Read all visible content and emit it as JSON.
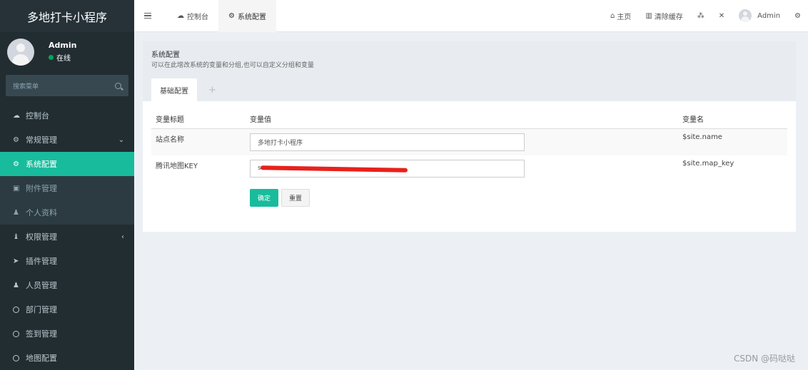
{
  "app": {
    "title": "多地打卡小程序"
  },
  "user": {
    "name": "Admin",
    "status": "在线"
  },
  "sidebar": {
    "search_placeholder": "搜索菜单",
    "items": [
      {
        "label": "控制台",
        "icon": "dashboard-icon",
        "glyph": "☁",
        "style": "normal"
      },
      {
        "label": "常规管理",
        "icon": "cogs-icon",
        "glyph": "⚙",
        "style": "normal",
        "arrow": "⌄"
      },
      {
        "label": "系统配置",
        "icon": "gear-icon",
        "glyph": "⚙",
        "style": "active"
      },
      {
        "label": "附件管理",
        "icon": "file-icon",
        "glyph": "▣",
        "style": "sub"
      },
      {
        "label": "个人资料",
        "icon": "user-icon",
        "glyph": "♟",
        "style": "sub"
      },
      {
        "label": "权限管理",
        "icon": "group-icon",
        "glyph": "♝",
        "style": "normal",
        "arrow": "‹"
      },
      {
        "label": "插件管理",
        "icon": "rocket-icon",
        "glyph": "➤",
        "style": "normal"
      },
      {
        "label": "人员管理",
        "icon": "user-icon",
        "glyph": "♟",
        "style": "normal"
      },
      {
        "label": "部门管理",
        "icon": "circle-icon",
        "glyph": "",
        "style": "normal"
      },
      {
        "label": "签到管理",
        "icon": "circle-icon",
        "glyph": "",
        "style": "normal"
      },
      {
        "label": "地图配置",
        "icon": "circle-icon",
        "glyph": "",
        "style": "normal"
      }
    ]
  },
  "header": {
    "tabs": [
      {
        "label": "控制台",
        "icon": "dashboard-icon",
        "glyph": "☁"
      },
      {
        "label": "系统配置",
        "icon": "gear-icon",
        "glyph": "⚙"
      }
    ],
    "right": {
      "home": "主页",
      "clear_cache": "清除缓存",
      "user": "Admin"
    }
  },
  "panel": {
    "title": "系统配置",
    "description": "可以在此增改系统的变量和分组,也可以自定义分组和变量",
    "tabs": {
      "basic": "基础配置",
      "add": "+"
    },
    "columns": {
      "title": "变量标题",
      "value": "变量值",
      "name": "变量名"
    },
    "rows": [
      {
        "title": "站点名称",
        "value": "多地打卡小程序",
        "name": "$site.name"
      },
      {
        "title": "腾讯地图KEY",
        "value": "s",
        "name": "$site.map_key"
      }
    ],
    "buttons": {
      "ok": "确定",
      "reset": "重置"
    }
  },
  "watermark": "CSDN @码哒哒",
  "colors": {
    "accent": "#18bc9c",
    "sidebar": "#222d32",
    "redaction": "#e8211c"
  }
}
